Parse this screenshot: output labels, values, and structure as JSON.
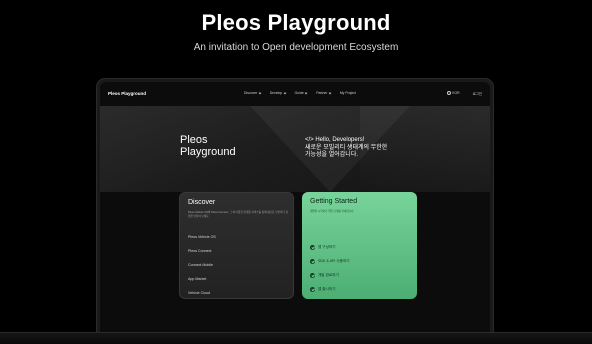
{
  "hero": {
    "title": "Pleos Playground",
    "subtitle": "An invitation to Open development Ecosystem"
  },
  "nav": {
    "logo": "Pleos Playground",
    "items": [
      {
        "label": "Discover"
      },
      {
        "label": "Develop"
      },
      {
        "label": "Guide"
      },
      {
        "label": "Partner"
      },
      {
        "label": "My Project"
      }
    ],
    "language": "KOR",
    "login": "로그인"
  },
  "banner": {
    "brand_line1": "Pleos",
    "brand_line2": "Playground",
    "hello_line1": "</> Hello, Developers!",
    "hello_line2": "새로운 모빌리티 생태계의 무한한",
    "hello_line3": "가능성을 열어갑니다."
  },
  "discover": {
    "title": "Discover",
    "description": "Pleos Vehicle OS와 Pleos Connect, 그 외 다양한 플랫폼 서비스를 통해 새로운 모빌리티 경험을 만들어 보세요.",
    "items": [
      "Pleos Vehicle OS",
      "Pleos Connect",
      "Connect Mobile",
      "App Market",
      "Vehicle Cloud"
    ]
  },
  "getting_started": {
    "title": "Getting Started",
    "description": "개발을 시작하기 위한 단계를 안내합니다.",
    "items": [
      "앱 구상하기",
      "SDK & API 사용하기",
      "개발 완료하기",
      "앱 출시하기"
    ]
  },
  "colors": {
    "accent_green": "#6cc48c",
    "background": "#000000"
  }
}
